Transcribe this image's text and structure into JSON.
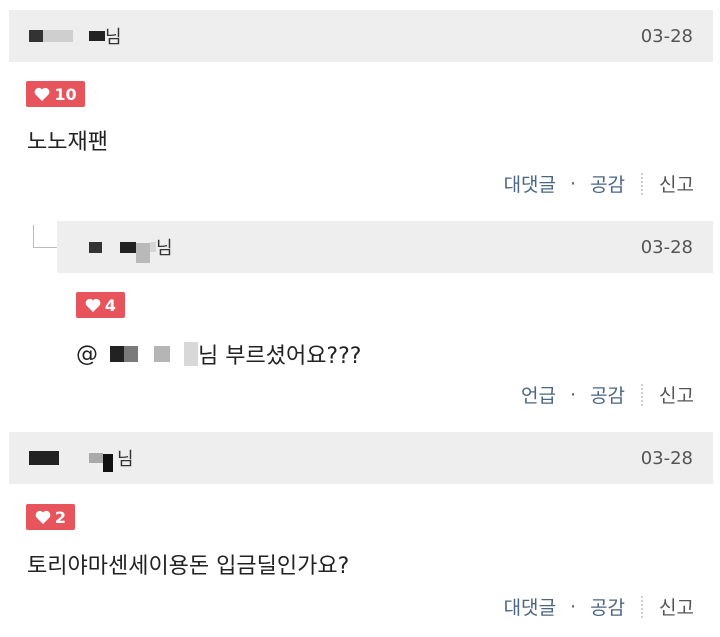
{
  "comments": [
    {
      "nickname_suffix": "님",
      "date": "03-28",
      "likes": "10",
      "text": "노노재팬",
      "actions": {
        "reply": "대댓글",
        "sympathy": "공감",
        "report": "신고"
      }
    },
    {
      "nickname_suffix": "님",
      "date": "03-28",
      "likes": "4",
      "text_prefix": "@",
      "text_suffix": "님 부르셨어요???",
      "actions": {
        "reply": "언급",
        "sympathy": "공감",
        "report": "신고"
      }
    },
    {
      "nickname_suffix": "님",
      "date": "03-28",
      "likes": "2",
      "text": "토리야마센세이용돈 입금딜인가요?",
      "actions": {
        "reply": "대댓글",
        "sympathy": "공감",
        "report": "신고"
      }
    }
  ],
  "colors": {
    "like_badge": "#e8545c",
    "header_bg": "#eeeeee",
    "action_link": "#4a6683"
  },
  "icons": {
    "like": "heart-icon"
  },
  "separator_dot": "·"
}
